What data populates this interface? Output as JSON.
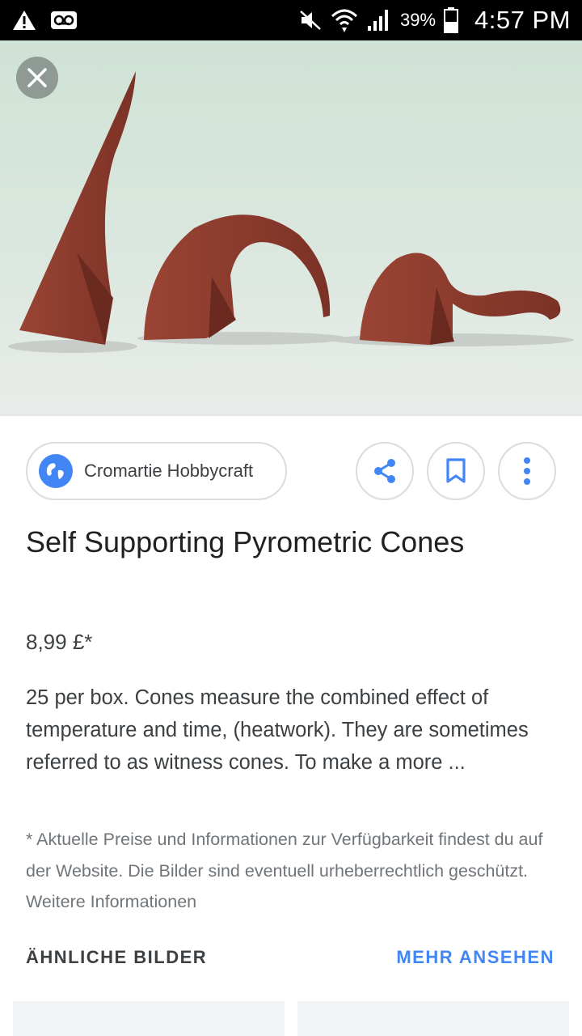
{
  "status_bar": {
    "battery_percent": "39%",
    "time": "4:57 PM",
    "icons": [
      "warning-icon",
      "voicemail-icon",
      "mute-icon",
      "wifi-icon",
      "signal-icon",
      "battery-icon"
    ]
  },
  "hero": {
    "icons": [
      "close-icon"
    ]
  },
  "source": {
    "name": "Cromartie Hobbycraft",
    "icon": "globe-icon",
    "actions": [
      "share-icon",
      "bookmark-icon",
      "more-vert-icon"
    ]
  },
  "item": {
    "title": "Self Supporting Pyrometric Cones",
    "price": "8,99 £*",
    "description": "25 per box. Cones measure the combined effect of temperature and time, (heatwork). They are sometimes referred to as witness cones. To make a more ...",
    "disclaimer": "* Aktuelle Preise und Informationen zur Verfügbarkeit findest du auf der Website. Die Bilder sind eventuell urheberrechtlich geschützt.",
    "disclaimer_link": "Weitere Informationen"
  },
  "related": {
    "heading": "ÄHNLICHE BILDER",
    "more_label": "MEHR ANSEHEN"
  },
  "colors": {
    "accent": "#4285f4",
    "cone": "#8a3a2e"
  }
}
